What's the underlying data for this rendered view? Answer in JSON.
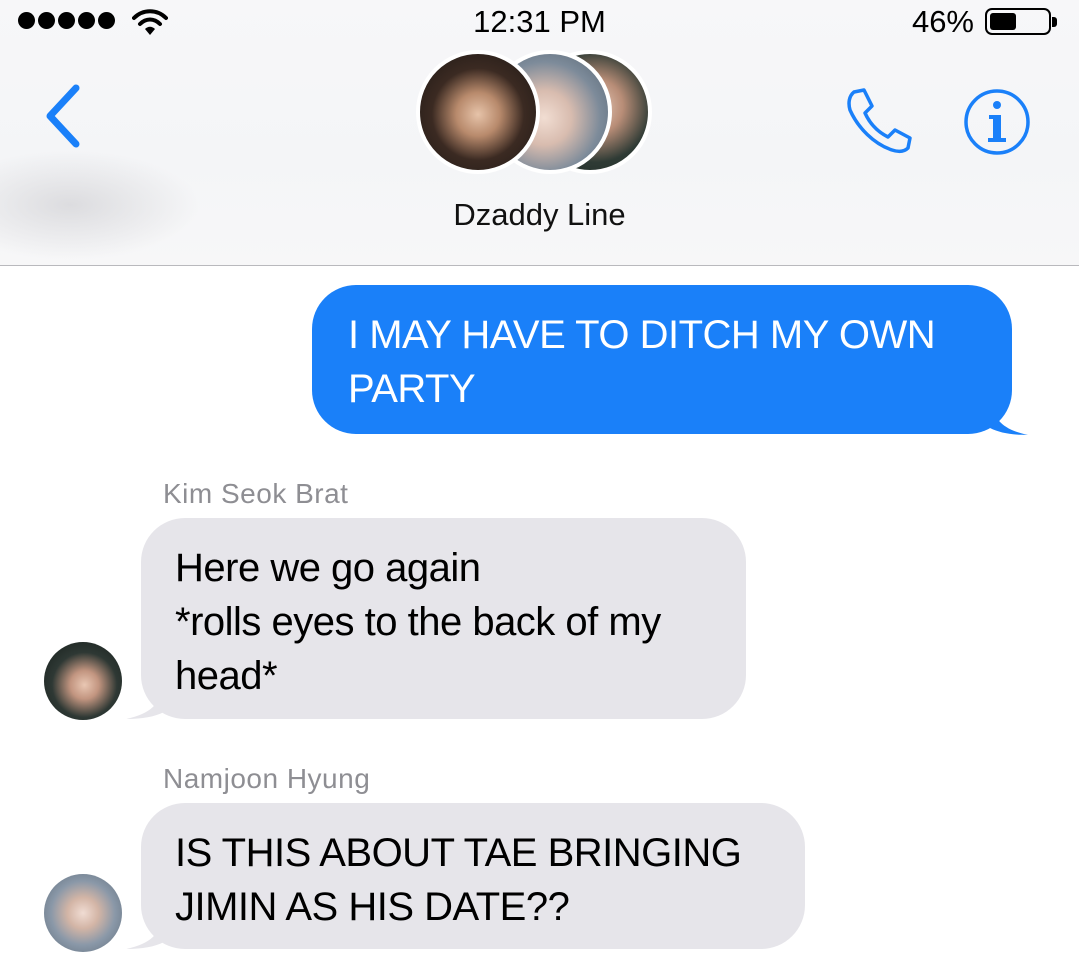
{
  "status_bar": {
    "time": "12:31 PM",
    "battery_percent": "46%",
    "battery_level": 0.46,
    "signal_dots": 5,
    "wifi_icon": "wifi-icon"
  },
  "header": {
    "group_name": "Dzaddy Line",
    "back_icon": "chevron-left-icon",
    "call_icon": "phone-icon",
    "info_icon": "info-icon",
    "accent_color": "#1a80f9"
  },
  "messages": [
    {
      "direction": "outgoing",
      "text": "I MAY HAVE TO DITCH MY OWN PARTY"
    },
    {
      "direction": "incoming",
      "sender": "Kim Seok Brat",
      "lines": [
        "Here we go again",
        "*rolls eyes to the back of my",
        "head*"
      ]
    },
    {
      "direction": "incoming",
      "sender": "Namjoon Hyung",
      "lines": [
        "IS THIS ABOUT TAE BRINGING",
        "JIMIN AS HIS DATE??"
      ]
    }
  ],
  "colors": {
    "outgoing_bubble": "#1a80f9",
    "incoming_bubble": "#e6e5ea",
    "sender_text": "#8e8e93"
  }
}
